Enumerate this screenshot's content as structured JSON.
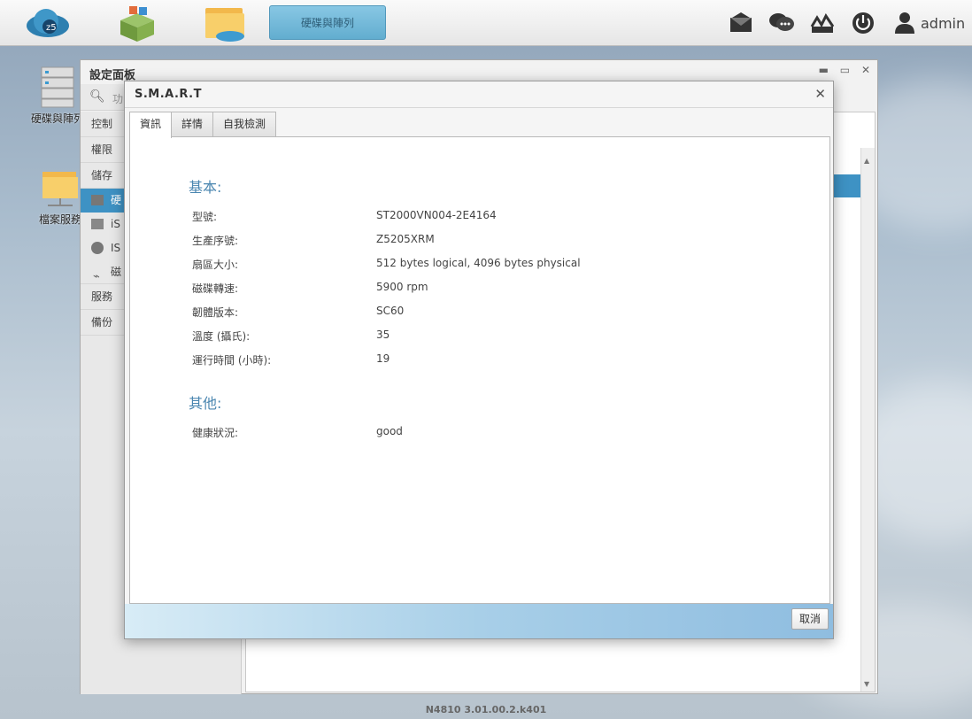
{
  "taskbar": {
    "active_app": "硬碟與陣列",
    "user": "admin",
    "left_icons": [
      "cloud-icon",
      "app-package-icon",
      "folder-icon"
    ],
    "right_icons": [
      "mail-icon",
      "chat-icon",
      "monitor-icon",
      "power-icon",
      "user-icon"
    ]
  },
  "desktop": {
    "icons": [
      {
        "label": "硬碟與陣列",
        "icon": "disk-array-icon"
      },
      {
        "label": "檔案服務",
        "icon": "file-service-icon"
      }
    ]
  },
  "settings_window": {
    "title": "設定面板",
    "search_placeholder": "功",
    "categories": [
      "控制",
      "權限",
      "儲存",
      "服務",
      "備份"
    ],
    "storage_items": [
      "硬",
      "iS",
      "IS",
      "磁"
    ]
  },
  "footer": {
    "version": "N4810   3.01.00.2.k401"
  },
  "dialog": {
    "title": "S.M.A.R.T",
    "tabs": [
      "資訊",
      "詳情",
      "自我檢測"
    ],
    "active_tab": "資訊",
    "basic_section_title": "基本:",
    "basic_rows": [
      {
        "label": "型號:",
        "value": "ST2000VN004-2E4164"
      },
      {
        "label": "生產序號:",
        "value": "Z5205XRM"
      },
      {
        "label": "扇區大小:",
        "value": "512 bytes logical, 4096 bytes physical"
      },
      {
        "label": "磁碟轉速:",
        "value": "5900 rpm"
      },
      {
        "label": "韌體版本:",
        "value": "SC60"
      },
      {
        "label": "溫度 (攝氏):",
        "value": "35"
      },
      {
        "label": "運行時間 (小時):",
        "value": "19"
      }
    ],
    "other_section_title": "其他:",
    "other_rows": [
      {
        "label": "健康狀況:",
        "value": "good"
      }
    ],
    "cancel_label": "取消",
    "colors": {
      "accent": "#3e92c4",
      "section_title": "#4a86b0"
    }
  }
}
